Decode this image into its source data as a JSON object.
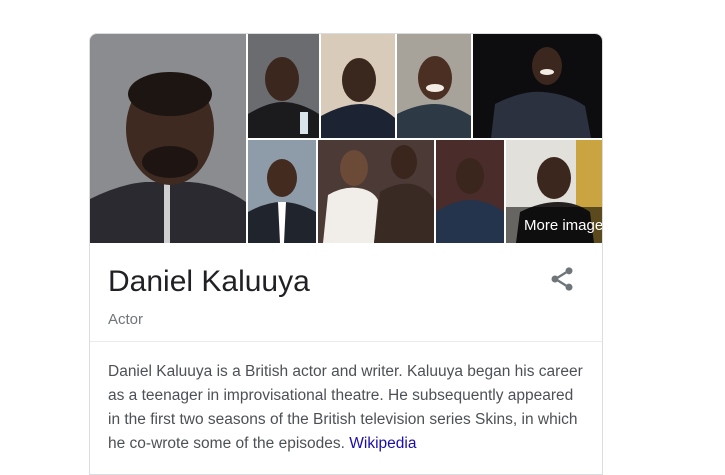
{
  "knowledge_panel": {
    "title": "Daniel Kaluuya",
    "subtitle": "Actor",
    "description": "Daniel Kaluuya is a British actor and writer. Kaluuya began his career as a teenager in improvisational theatre. He subsequently appeared in the first two seasons of the British television series Skins, in which he co-wrote some of the episodes.",
    "source_link": "Wikipedia",
    "more_images_label": "More images",
    "share_icon": "share-icon",
    "image_icon": "image-icon"
  },
  "colors": {
    "title": "#202124",
    "subtitle": "#70757a",
    "description": "#4d5156",
    "link": "#1a0dab",
    "border": "#dadce0"
  }
}
